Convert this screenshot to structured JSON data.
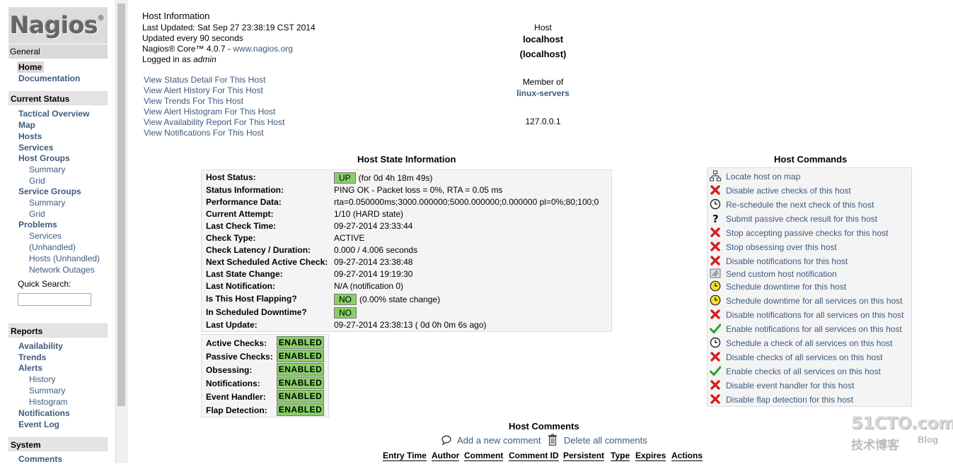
{
  "sidebar": {
    "logo": "Nagios",
    "logo_mark": "®",
    "general": "General",
    "home": "Home",
    "documentation": "Documentation",
    "current_status": "Current Status",
    "tactical": "Tactical Overview",
    "map": "Map",
    "hosts": "Hosts",
    "services": "Services",
    "host_groups": "Host Groups",
    "hg_summary": "Summary",
    "hg_grid": "Grid",
    "service_groups": "Service Groups",
    "sg_summary": "Summary",
    "sg_grid": "Grid",
    "problems": "Problems",
    "pr_services": "Services",
    "pr_unhandled": "(Unhandled)",
    "pr_hosts": "Hosts (Unhandled)",
    "pr_outages": "Network Outages",
    "quick_search": "Quick Search:",
    "reports": "Reports",
    "availability": "Availability",
    "trends": "Trends",
    "alerts": "Alerts",
    "al_history": "History",
    "al_summary": "Summary",
    "al_histogram": "Histogram",
    "notifications": "Notifications",
    "event_log": "Event Log",
    "system": "System",
    "comments": "Comments"
  },
  "info": {
    "title": "Host Information",
    "last_updated": "Last Updated: Sat Sep 27 23:38:19 CST 2014",
    "updated_every": "Updated every 90 seconds",
    "core_version": "Nagios® Core™ 4.0.7 - ",
    "core_link": "www.nagios.org",
    "logged_in_prefix": "Logged in as ",
    "user": "admin",
    "links": [
      "View Status Detail For This Host",
      "View Alert History For This Host",
      "View Trends For This Host",
      "View Alert Histogram For This Host",
      "View Availability Report For This Host",
      "View Notifications For This Host"
    ]
  },
  "host": {
    "label": "Host",
    "name": "localhost",
    "alias": "(localhost)",
    "member_of": "Member of",
    "group": "linux-servers",
    "address": "127.0.0.1"
  },
  "state": {
    "title": "Host State Information",
    "rows": [
      {
        "label": "Host Status:",
        "badge": "UP",
        "value": "(for 0d 4h 18m 49s)"
      },
      {
        "label": "Status Information:",
        "value": "PING OK - Packet loss = 0%, RTA = 0.05 ms"
      },
      {
        "label": "Performance Data:",
        "value": "rta=0.050000ms;3000.000000;5000.000000;0.000000 pl=0%;80;100;0"
      },
      {
        "label": "Current Attempt:",
        "value": "1/10  (HARD state)"
      },
      {
        "label": "Last Check Time:",
        "value": "09-27-2014 23:33:44"
      },
      {
        "label": "Check Type:",
        "value": "ACTIVE"
      },
      {
        "label": "Check Latency / Duration:",
        "value": "0.000 / 4.006 seconds"
      },
      {
        "label": "Next Scheduled Active Check:",
        "value": "09-27-2014 23:38:48"
      },
      {
        "label": "Last State Change:",
        "value": "09-27-2014 19:19:30"
      },
      {
        "label": "Last Notification:",
        "value": "N/A (notification 0)"
      },
      {
        "label": "Is This Host Flapping?",
        "badge": "NO",
        "value": "(0.00% state change)"
      },
      {
        "label": "In Scheduled Downtime?",
        "badge": "NO",
        "value": ""
      },
      {
        "label": "Last Update:",
        "value": "09-27-2014 23:38:13  ( 0d 0h 0m 6s ago)"
      }
    ],
    "checks": [
      {
        "label": "Active Checks:",
        "value": "ENABLED"
      },
      {
        "label": "Passive Checks:",
        "value": "ENABLED"
      },
      {
        "label": "Obsessing:",
        "value": "ENABLED"
      },
      {
        "label": "Notifications:",
        "value": "ENABLED"
      },
      {
        "label": "Event Handler:",
        "value": "ENABLED"
      },
      {
        "label": "Flap Detection:",
        "value": "ENABLED"
      }
    ]
  },
  "commands": {
    "title": "Host Commands",
    "items": [
      {
        "icon": "map-icon",
        "label": "Locate host on map"
      },
      {
        "icon": "disable-icon",
        "label": "Disable active checks of this host"
      },
      {
        "icon": "clock-icon",
        "label": "Re-schedule the next check of this host"
      },
      {
        "icon": "question-icon",
        "label": "Submit passive check result for this host"
      },
      {
        "icon": "disable-icon",
        "label": "Stop accepting passive checks for this host"
      },
      {
        "icon": "disable-icon",
        "label": "Stop obsessing over this host"
      },
      {
        "icon": "disable-icon",
        "label": "Disable notifications for this host"
      },
      {
        "icon": "notify-icon",
        "label": "Send custom host notification"
      },
      {
        "icon": "downtime-icon",
        "label": "Schedule downtime for this host"
      },
      {
        "icon": "downtime-icon",
        "label": "Schedule downtime for all services on this host"
      },
      {
        "icon": "disable-icon",
        "label": "Disable notifications for all services on this host"
      },
      {
        "icon": "enable-icon",
        "label": "Enable notifications for all services on this host"
      },
      {
        "icon": "clock-icon",
        "label": "Schedule a check of all services on this host"
      },
      {
        "icon": "disable-icon",
        "label": "Disable checks of all services on this host"
      },
      {
        "icon": "enable-icon",
        "label": "Enable checks of all services on this host"
      },
      {
        "icon": "disable-icon",
        "label": "Disable event handler for this host"
      },
      {
        "icon": "disable-icon",
        "label": "Disable flap detection for this host"
      }
    ]
  },
  "comments": {
    "title": "Host Comments",
    "add": "Add a new comment",
    "delete": "Delete all comments",
    "columns": [
      "Entry Time",
      "Author",
      "Comment",
      "Comment ID",
      "Persistent",
      "Type",
      "Expires",
      "Actions"
    ]
  },
  "watermark": {
    "brand": "51CTO.com",
    "sub": "技术博客",
    "blog": "Blog"
  },
  "colors": {
    "link": "#3d5a80",
    "badge_green": "#88d066",
    "panel_bg": "#f4f4f4",
    "disable_red": "#d42020",
    "enable_green": "#2ea02e"
  }
}
